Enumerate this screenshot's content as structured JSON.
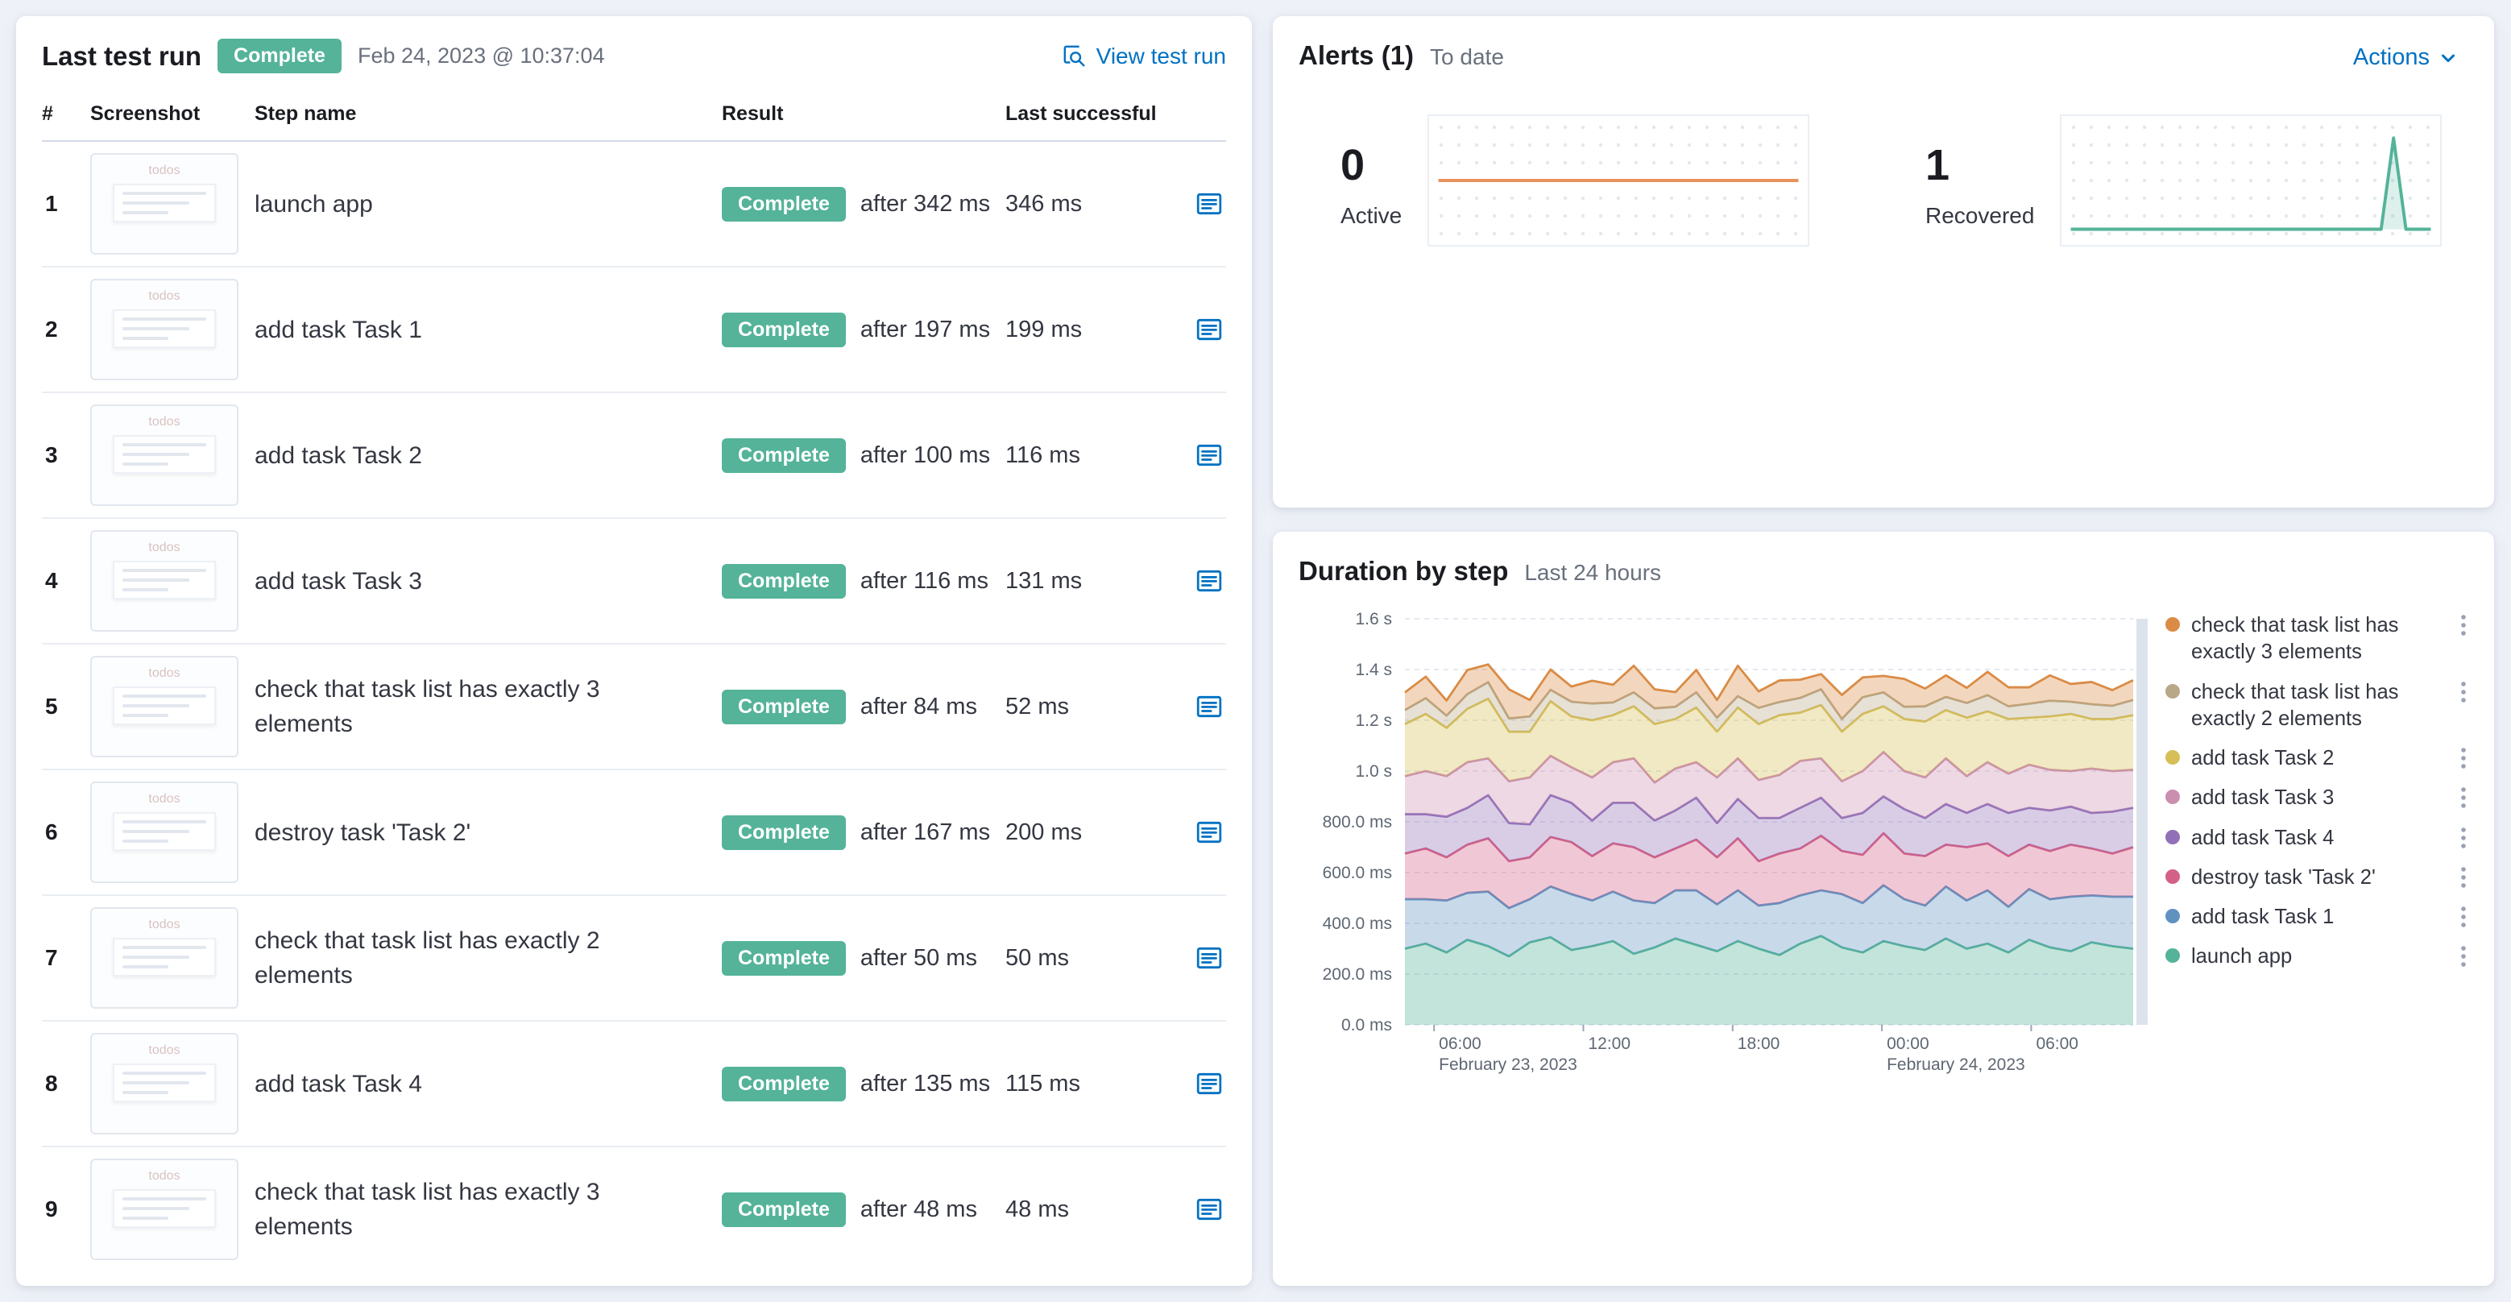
{
  "page": {
    "background": "#eef1f8"
  },
  "last_test_run": {
    "title": "Last test run",
    "status_badge": "Complete",
    "timestamp": "Feb 24, 2023 @ 10:37:04",
    "view_link": "View test run",
    "columns": {
      "num": "#",
      "screenshot": "Screenshot",
      "step": "Step name",
      "result": "Result",
      "last_successful": "Last successful"
    },
    "thumbnail_label": "todos",
    "steps": [
      {
        "num": "1",
        "name": "launch app",
        "result_badge": "Complete",
        "after": "after 342 ms",
        "last": "346 ms"
      },
      {
        "num": "2",
        "name": "add task Task 1",
        "result_badge": "Complete",
        "after": "after 197 ms",
        "last": "199 ms"
      },
      {
        "num": "3",
        "name": "add task Task 2",
        "result_badge": "Complete",
        "after": "after 100 ms",
        "last": "116 ms"
      },
      {
        "num": "4",
        "name": "add task Task 3",
        "result_badge": "Complete",
        "after": "after 116 ms",
        "last": "131 ms"
      },
      {
        "num": "5",
        "name": "check that task list has exactly 3 elements",
        "result_badge": "Complete",
        "after": "after 84 ms",
        "last": "52 ms"
      },
      {
        "num": "6",
        "name": "destroy task 'Task 2'",
        "result_badge": "Complete",
        "after": "after 167 ms",
        "last": "200 ms"
      },
      {
        "num": "7",
        "name": "check that task list has exactly 2 elements",
        "result_badge": "Complete",
        "after": "after 50 ms",
        "last": "50 ms"
      },
      {
        "num": "8",
        "name": "add task Task 4",
        "result_badge": "Complete",
        "after": "after 135 ms",
        "last": "115 ms"
      },
      {
        "num": "9",
        "name": "check that task list has exactly 3 elements",
        "result_badge": "Complete",
        "after": "after 48 ms",
        "last": "48 ms"
      }
    ]
  },
  "alerts": {
    "title": "Alerts (1)",
    "subtitle": "To date",
    "actions_label": "Actions",
    "stats": [
      {
        "count": "0",
        "label": "Active",
        "color": "#E8935C",
        "fill": false,
        "values": [
          0,
          0
        ]
      },
      {
        "count": "1",
        "label": "Recovered",
        "color": "#54B399",
        "fill": true,
        "values": [
          0,
          0,
          0,
          0,
          0,
          0,
          0,
          0,
          0,
          0,
          0,
          0,
          0,
          0,
          0,
          0,
          0,
          0,
          0,
          0,
          0,
          0,
          0,
          0,
          0,
          0,
          1,
          0,
          0,
          0
        ]
      }
    ]
  },
  "duration": {
    "title": "Duration by step",
    "subtitle": "Last 24 hours",
    "chart_data": {
      "type": "area",
      "stacked": true,
      "title": "Duration by step",
      "xlabel": "",
      "ylabel": "",
      "ylim": [
        0,
        1600
      ],
      "y_ticks": [
        {
          "v": 0,
          "label": "0.0 ms"
        },
        {
          "v": 200,
          "label": "200.0 ms"
        },
        {
          "v": 400,
          "label": "400.0 ms"
        },
        {
          "v": 600,
          "label": "600.0 ms"
        },
        {
          "v": 800,
          "label": "800.0 ms"
        },
        {
          "v": 1000,
          "label": "1.0 s"
        },
        {
          "v": 1200,
          "label": "1.2 s"
        },
        {
          "v": 1400,
          "label": "1.4 s"
        },
        {
          "v": 1600,
          "label": "1.6 s"
        }
      ],
      "x_ticks": [
        {
          "pos": 0.04,
          "label": "06:00"
        },
        {
          "pos": 0.245,
          "label": "12:00"
        },
        {
          "pos": 0.45,
          "label": "18:00"
        },
        {
          "pos": 0.655,
          "label": "00:00"
        },
        {
          "pos": 0.86,
          "label": "06:00"
        }
      ],
      "x_dates": [
        {
          "pos": 0.04,
          "label": "February 23, 2023"
        },
        {
          "pos": 0.655,
          "label": "February 24, 2023"
        }
      ],
      "series": [
        {
          "name": "launch app",
          "color": "#54B399",
          "values": [
            300,
            320,
            285,
            335,
            310,
            270,
            325,
            345,
            295,
            310,
            330,
            280,
            305,
            340,
            315,
            290,
            330,
            300,
            275,
            320,
            350,
            305,
            285,
            330,
            310,
            295,
            340,
            300,
            320,
            285,
            335,
            305,
            290,
            325,
            310,
            300
          ]
        },
        {
          "name": "add task Task 1",
          "color": "#6092C0",
          "values": [
            195,
            175,
            205,
            185,
            215,
            190,
            170,
            200,
            220,
            180,
            195,
            210,
            175,
            190,
            215,
            185,
            200,
            170,
            205,
            190,
            180,
            210,
            195,
            220,
            185,
            175,
            205,
            190,
            210,
            180,
            200,
            190,
            215,
            185,
            195,
            205
          ]
        },
        {
          "name": "destroy task 'Task 2'",
          "color": "#D36086",
          "values": [
            180,
            200,
            170,
            190,
            210,
            185,
            165,
            195,
            205,
            175,
            190,
            210,
            180,
            165,
            200,
            185,
            205,
            175,
            195,
            185,
            215,
            170,
            190,
            205,
            180,
            195,
            165,
            210,
            185,
            200,
            175,
            190,
            205,
            185,
            170,
            195
          ]
        },
        {
          "name": "add task Task 4",
          "color": "#9170B8",
          "values": [
            155,
            135,
            160,
            145,
            170,
            150,
            130,
            165,
            155,
            140,
            160,
            175,
            145,
            150,
            165,
            135,
            155,
            170,
            140,
            160,
            150,
            130,
            165,
            145,
            175,
            150,
            160,
            135,
            155,
            170,
            145,
            160,
            150,
            140,
            165,
            155
          ]
        },
        {
          "name": "add task Task 3",
          "color": "#CA8EAE",
          "values": [
            150,
            170,
            160,
            180,
            145,
            165,
            185,
            155,
            140,
            170,
            160,
            175,
            150,
            165,
            140,
            180,
            160,
            150,
            170,
            185,
            155,
            145,
            165,
            175,
            150,
            160,
            180,
            145,
            165,
            155,
            170,
            160,
            140,
            175,
            160,
            150
          ]
        },
        {
          "name": "add task Task 2",
          "color": "#D6BF57",
          "values": [
            205,
            225,
            190,
            210,
            235,
            195,
            180,
            215,
            200,
            225,
            185,
            205,
            230,
            195,
            215,
            180,
            200,
            220,
            235,
            190,
            210,
            195,
            225,
            180,
            205,
            220,
            190,
            230,
            200,
            215,
            185,
            210,
            225,
            195,
            205,
            215
          ]
        },
        {
          "name": "check that task list has exactly 2 elements",
          "color": "#B9A888",
          "values": [
            55,
            62,
            48,
            58,
            65,
            52,
            60,
            45,
            58,
            66,
            50,
            55,
            62,
            48,
            60,
            55,
            45,
            64,
            52,
            58,
            62,
            50,
            66,
            55,
            48,
            60,
            52,
            58,
            64,
            50,
            55,
            62,
            48,
            58,
            52,
            60
          ]
        },
        {
          "name": "check that task list has exactly 3 elements",
          "color": "#DA8B45",
          "values": [
            70,
            85,
            60,
            95,
            70,
            115,
            65,
            80,
            60,
            90,
            70,
            105,
            75,
            58,
            88,
            70,
            120,
            65,
            85,
            72,
            60,
            95,
            78,
            65,
            110,
            70,
            85,
            60,
            92,
            75,
            65,
            100,
            70,
            88,
            62,
            78
          ]
        }
      ],
      "legend_position": "right"
    }
  }
}
